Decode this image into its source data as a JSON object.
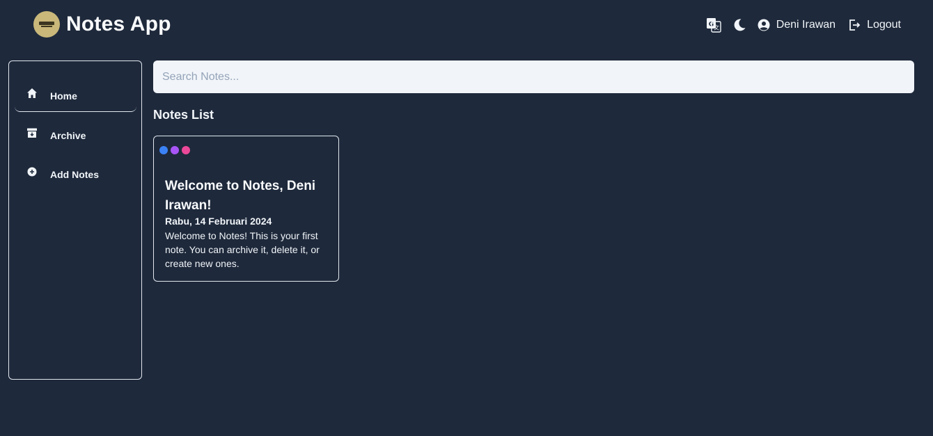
{
  "header": {
    "logo_icon": "notes-app-logo",
    "title": "Notes App",
    "translate_icon": "translate-icon",
    "theme_icon": "moon-icon",
    "user_icon": "user-circle-icon",
    "user_name": "Deni Irawan",
    "logout_icon": "logout-icon",
    "logout_label": "Logout"
  },
  "sidebar": {
    "items": [
      {
        "label": "Home",
        "icon": "home-icon",
        "active": true
      },
      {
        "label": "Archive",
        "icon": "archive-icon",
        "active": false
      },
      {
        "label": "Add Notes",
        "icon": "plus-circle-icon",
        "active": false
      }
    ]
  },
  "search": {
    "placeholder": "Search Notes...",
    "value": ""
  },
  "main": {
    "section_title": "Notes List",
    "notes": [
      {
        "dot_colors": [
          "#3b82f6",
          "#a855f7",
          "#ec4899"
        ],
        "title": "Welcome to Notes, Deni Irawan!",
        "date": "Rabu, 14 Februari 2024",
        "body": "Welcome to Notes! This is your first note. You can archive it, delete it, or create new ones."
      }
    ]
  },
  "colors": {
    "background": "#1e293b",
    "text": "#f1f5f9",
    "border": "#e2e8f0",
    "search_bg": "#f1f5f9",
    "logo_bg": "#c9b87a"
  }
}
